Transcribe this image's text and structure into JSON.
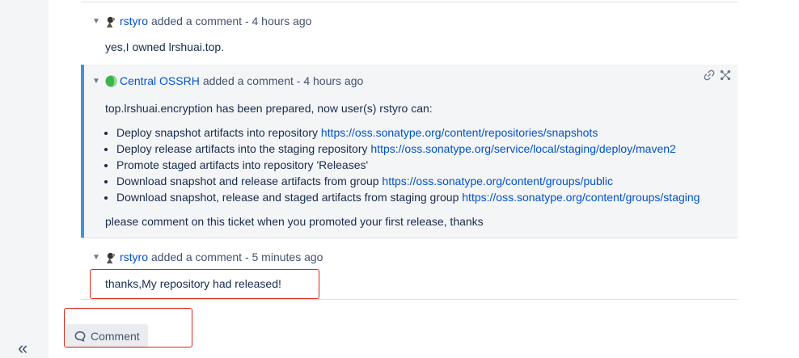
{
  "comments": [
    {
      "author": "rstyro",
      "meta": "added a comment - 4 hours ago",
      "body": "yes,I owned lrshuai.top."
    },
    {
      "author": "Central OSSRH",
      "meta": "added a comment - 4 hours ago",
      "intro": "top.lrshuai.encryption has been prepared, now user(s) rstyro can:",
      "items": [
        {
          "text": "Deploy snapshot artifacts into repository ",
          "link": "https://oss.sonatype.org/content/repositories/snapshots"
        },
        {
          "text": "Deploy release artifacts into the staging repository ",
          "link": "https://oss.sonatype.org/service/local/staging/deploy/maven2"
        },
        {
          "text": "Promote staged artifacts into repository 'Releases'",
          "link": ""
        },
        {
          "text": "Download snapshot and release artifacts from group ",
          "link": "https://oss.sonatype.org/content/groups/public"
        },
        {
          "text": "Download snapshot, release and staged artifacts from staging group ",
          "link": "https://oss.sonatype.org/content/groups/staging"
        }
      ],
      "outro": "please comment on this ticket when you promoted your first release, thanks"
    },
    {
      "author": "rstyro",
      "meta": "added a comment - 5 minutes ago",
      "body": "thanks,My repository had released!"
    }
  ],
  "comment_button": {
    "label": "Comment"
  },
  "icons": {
    "collapse": "double-chevron-left-icon",
    "chevron": "chevron-down-icon",
    "permalink": "link-icon",
    "more": "more-icon"
  },
  "colors": {
    "link": "#0052cc",
    "highlight_border": "#4a90d9",
    "annotation": "#e0241b"
  }
}
